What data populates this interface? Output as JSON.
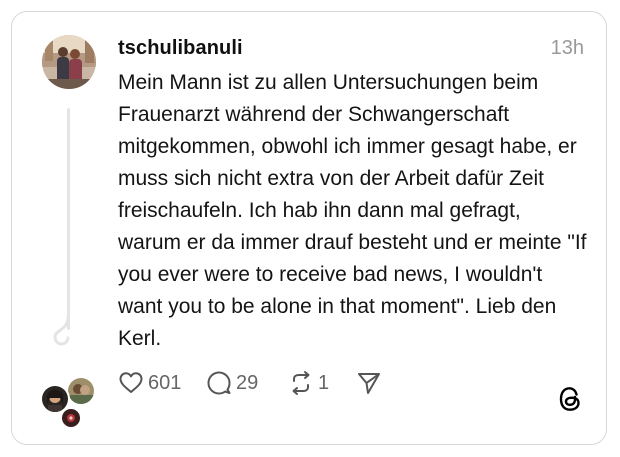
{
  "post": {
    "username": "tschulibanuli",
    "timestamp": "13h",
    "text": "Mein Mann ist zu allen Untersuchungen beim Frauenarzt während der Schwangerschaft mitgekommen, obwohl ich immer gesagt habe, er muss sich nicht extra von der Arbeit dafür Zeit freischaufeln. Ich hab ihn dann mal gefragt, warum er da immer drauf besteht und er meinte \"If you ever were to receive bad news, I wouldn't want you to be alone in that moment\". Lieb den Kerl."
  },
  "actions": {
    "likes": "601",
    "replies": "29",
    "reposts": "1"
  },
  "icons": {
    "like": "heart-icon",
    "reply": "comment-bubble-icon",
    "repost": "repost-icon",
    "share": "send-icon",
    "brand": "threads-logo-icon"
  },
  "colors": {
    "text": "#101010",
    "muted": "#999999",
    "action": "#666666",
    "border": "#d8d8d8"
  }
}
